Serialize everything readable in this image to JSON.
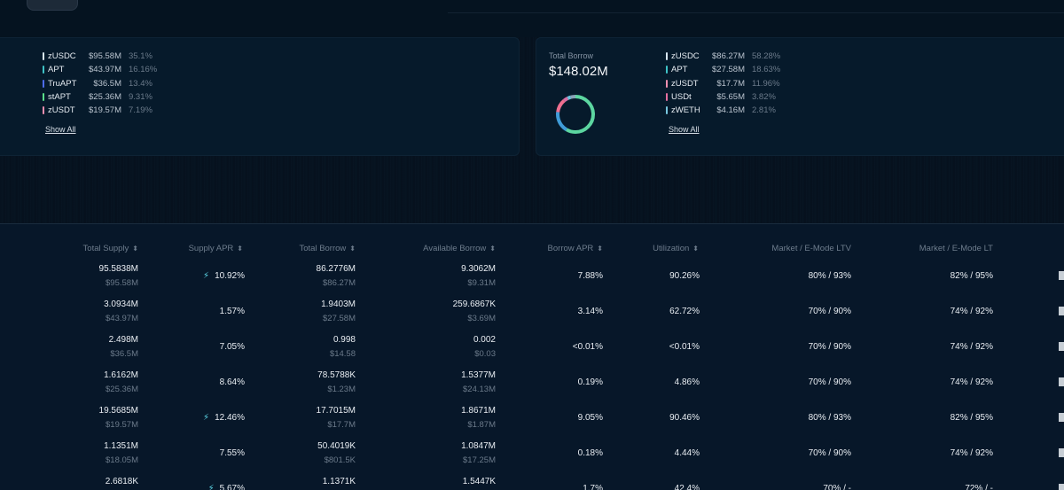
{
  "supply_legend": {
    "items": [
      {
        "name": "zUSDC",
        "value": "$95.58M",
        "pct": "35.1%",
        "color": "#d8e7f2"
      },
      {
        "name": "APT",
        "value": "$43.97M",
        "pct": "16.16%",
        "color": "#3fc4c8"
      },
      {
        "name": "TruAPT",
        "value": "$36.5M",
        "pct": "13.4%",
        "color": "#4d6cf0"
      },
      {
        "name": "stAPT",
        "value": "$25.36M",
        "pct": "9.31%",
        "color": "#5be08a"
      },
      {
        "name": "zUSDT",
        "value": "$19.57M",
        "pct": "7.19%",
        "color": "#ef8fb0"
      }
    ],
    "show_all": "Show All"
  },
  "borrow_summary": {
    "label": "Total Borrow",
    "value": "$148.02M",
    "donut": [
      {
        "share": 0.5828,
        "color": "#5cd6a0"
      },
      {
        "share": 0.1863,
        "color": "#3f9cd8"
      },
      {
        "share": 0.1196,
        "color": "#ef6f8f"
      },
      {
        "share": 0.0382,
        "color": "#d86fa4"
      },
      {
        "share": 0.0281,
        "color": "#6cc4de"
      },
      {
        "share": 0.045,
        "color": "#8aa3b8"
      }
    ]
  },
  "borrow_legend": {
    "items": [
      {
        "name": "zUSDC",
        "value": "$86.27M",
        "pct": "58.28%",
        "color": "#d8e7f2"
      },
      {
        "name": "APT",
        "value": "$27.58M",
        "pct": "18.63%",
        "color": "#3fc4c8"
      },
      {
        "name": "zUSDT",
        "value": "$17.7M",
        "pct": "11.96%",
        "color": "#ef8fb0"
      },
      {
        "name": "USDt",
        "value": "$5.65M",
        "pct": "3.82%",
        "color": "#e56fa0"
      },
      {
        "name": "zWETH",
        "value": "$4.16M",
        "pct": "2.81%",
        "color": "#78c8e0"
      }
    ],
    "show_all": "Show All"
  },
  "table": {
    "headers": [
      "Total Supply",
      "Supply APR",
      "Total Borrow",
      "Available Borrow",
      "Borrow APR",
      "Utilization",
      "Market / E-Mode LTV",
      "Market / E-Mode LT"
    ],
    "rows": [
      {
        "supply": "95.5838M",
        "supply_usd": "$95.58M",
        "supply_apr": "10.92%",
        "boost": true,
        "borrow": "86.2776M",
        "borrow_usd": "$86.27M",
        "avail": "9.3062M",
        "avail_usd": "$9.31M",
        "borrow_apr": "7.88%",
        "util": "90.26%",
        "ltv": "80% / 93%",
        "lt": "82% / 95%"
      },
      {
        "supply": "3.0934M",
        "supply_usd": "$43.97M",
        "supply_apr": "1.57%",
        "boost": false,
        "borrow": "1.9403M",
        "borrow_usd": "$27.58M",
        "avail": "259.6867K",
        "avail_usd": "$3.69M",
        "borrow_apr": "3.14%",
        "util": "62.72%",
        "ltv": "70% / 90%",
        "lt": "74% / 92%"
      },
      {
        "supply": "2.498M",
        "supply_usd": "$36.5M",
        "supply_apr": "7.05%",
        "boost": false,
        "borrow": "0.998",
        "borrow_usd": "$14.58",
        "avail": "0.002",
        "avail_usd": "$0.03",
        "borrow_apr": "<0.01%",
        "util": "<0.01%",
        "ltv": "70% / 90%",
        "lt": "74% / 92%"
      },
      {
        "supply": "1.6162M",
        "supply_usd": "$25.36M",
        "supply_apr": "8.64%",
        "boost": false,
        "borrow": "78.5788K",
        "borrow_usd": "$1.23M",
        "avail": "1.5377M",
        "avail_usd": "$24.13M",
        "borrow_apr": "0.19%",
        "util": "4.86%",
        "ltv": "70% / 90%",
        "lt": "74% / 92%"
      },
      {
        "supply": "19.5685M",
        "supply_usd": "$19.57M",
        "supply_apr": "12.46%",
        "boost": true,
        "borrow": "17.7015M",
        "borrow_usd": "$17.7M",
        "avail": "1.8671M",
        "avail_usd": "$1.87M",
        "borrow_apr": "9.05%",
        "util": "90.46%",
        "ltv": "80% / 93%",
        "lt": "82% / 95%"
      },
      {
        "supply": "1.1351M",
        "supply_usd": "$18.05M",
        "supply_apr": "7.55%",
        "boost": false,
        "borrow": "50.4019K",
        "borrow_usd": "$801.5K",
        "avail": "1.0847M",
        "avail_usd": "$17.25M",
        "borrow_apr": "0.18%",
        "util": "4.44%",
        "ltv": "70% / 90%",
        "lt": "74% / 92%"
      },
      {
        "supply": "2.6818K",
        "supply_usd": "",
        "supply_apr": "5.67%",
        "boost": true,
        "borrow": "1.1371K",
        "borrow_usd": "",
        "avail": "1.5447K",
        "avail_usd": "",
        "borrow_apr": "1.7%",
        "util": "42.4%",
        "ltv": "70% / -",
        "lt": "72% / -"
      }
    ]
  }
}
